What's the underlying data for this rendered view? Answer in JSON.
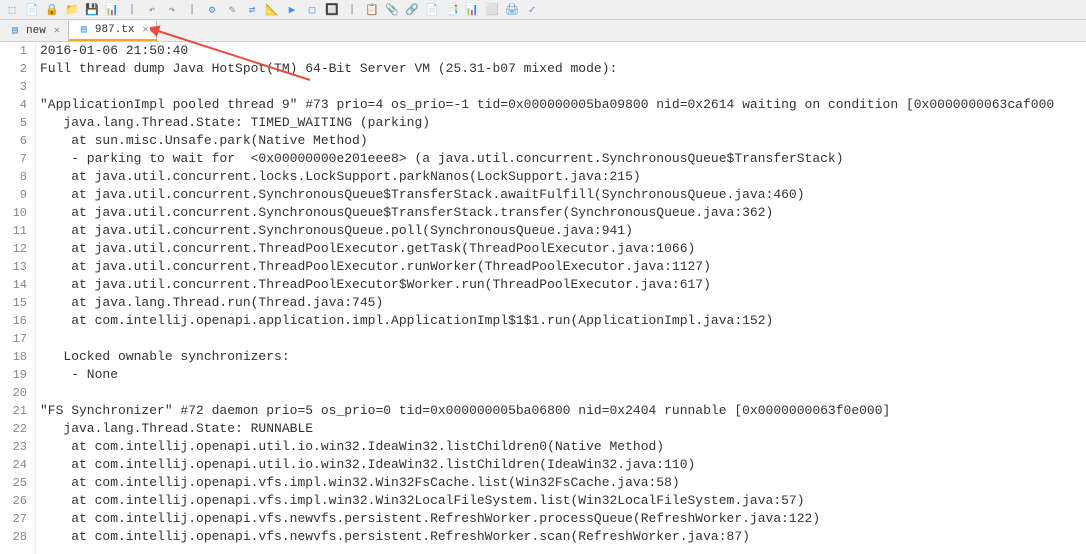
{
  "toolbar": {
    "icons": [
      "📋",
      "📄",
      "🔒",
      "📁",
      "💾",
      "📊",
      "🔍",
      "↩",
      "↪",
      "🔧",
      "📝",
      "🔀",
      "📐",
      "▶",
      "▢",
      "🔲",
      "⚙",
      "📋",
      "📎",
      "🔗",
      "📄",
      "📑",
      "📊",
      "⬜",
      "⬜",
      "🖨",
      "✓"
    ]
  },
  "tabs": {
    "inactive": {
      "label": "new",
      "close": "✕"
    },
    "active": {
      "label": "987.tx",
      "close": "✕"
    }
  },
  "code": {
    "lines": [
      "2016-01-06 21:50:40",
      "Full thread dump Java HotSpot(TM) 64-Bit Server VM (25.31-b07 mixed mode):",
      "",
      "\"ApplicationImpl pooled thread 9\" #73 prio=4 os_prio=-1 tid=0x000000005ba09800 nid=0x2614 waiting on condition [0x0000000063caf000",
      "   java.lang.Thread.State: TIMED_WAITING (parking)",
      "    at sun.misc.Unsafe.park(Native Method)",
      "    - parking to wait for  <0x00000000e201eee8> (a java.util.concurrent.SynchronousQueue$TransferStack)",
      "    at java.util.concurrent.locks.LockSupport.parkNanos(LockSupport.java:215)",
      "    at java.util.concurrent.SynchronousQueue$TransferStack.awaitFulfill(SynchronousQueue.java:460)",
      "    at java.util.concurrent.SynchronousQueue$TransferStack.transfer(SynchronousQueue.java:362)",
      "    at java.util.concurrent.SynchronousQueue.poll(SynchronousQueue.java:941)",
      "    at java.util.concurrent.ThreadPoolExecutor.getTask(ThreadPoolExecutor.java:1066)",
      "    at java.util.concurrent.ThreadPoolExecutor.runWorker(ThreadPoolExecutor.java:1127)",
      "    at java.util.concurrent.ThreadPoolExecutor$Worker.run(ThreadPoolExecutor.java:617)",
      "    at java.lang.Thread.run(Thread.java:745)",
      "    at com.intellij.openapi.application.impl.ApplicationImpl$1$1.run(ApplicationImpl.java:152)",
      "",
      "   Locked ownable synchronizers:",
      "    - None",
      "",
      "\"FS Synchronizer\" #72 daemon prio=5 os_prio=0 tid=0x000000005ba06800 nid=0x2404 runnable [0x0000000063f0e000]",
      "   java.lang.Thread.State: RUNNABLE",
      "    at com.intellij.openapi.util.io.win32.IdeaWin32.listChildren0(Native Method)",
      "    at com.intellij.openapi.util.io.win32.IdeaWin32.listChildren(IdeaWin32.java:110)",
      "    at com.intellij.openapi.vfs.impl.win32.Win32FsCache.list(Win32FsCache.java:58)",
      "    at com.intellij.openapi.vfs.impl.win32.Win32LocalFileSystem.list(Win32LocalFileSystem.java:57)",
      "    at com.intellij.openapi.vfs.newvfs.persistent.RefreshWorker.processQueue(RefreshWorker.java:122)",
      "    at com.intellij.openapi.vfs.newvfs.persistent.RefreshWorker.scan(RefreshWorker.java:87)"
    ]
  }
}
